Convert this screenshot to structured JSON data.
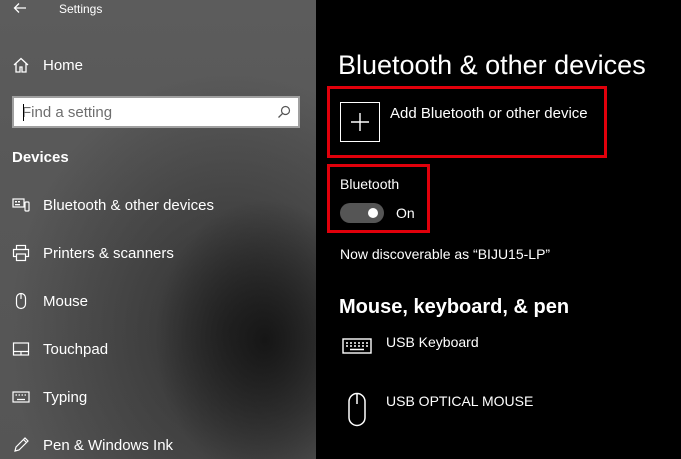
{
  "window": {
    "title": "Settings"
  },
  "sidebar": {
    "home_label": "Home",
    "search": {
      "placeholder": "Find a setting"
    },
    "section_title": "Devices",
    "items": [
      {
        "label": "Bluetooth & other devices",
        "icon": "bluetooth-devices-icon"
      },
      {
        "label": "Printers & scanners",
        "icon": "printer-icon"
      },
      {
        "label": "Mouse",
        "icon": "mouse-icon"
      },
      {
        "label": "Touchpad",
        "icon": "touchpad-icon"
      },
      {
        "label": "Typing",
        "icon": "keyboard-icon"
      },
      {
        "label": "Pen & Windows Ink",
        "icon": "pen-icon"
      }
    ]
  },
  "main": {
    "title": "Bluetooth & other devices",
    "add_device_label": "Add Bluetooth or other device",
    "bluetooth": {
      "label": "Bluetooth",
      "state": "On",
      "enabled": true
    },
    "discoverable_text": "Now discoverable as “BIJU15-LP”",
    "input_section_title": "Mouse, keyboard, & pen",
    "devices": [
      {
        "name": "USB Keyboard",
        "icon": "keyboard-icon"
      },
      {
        "name": "USB OPTICAL MOUSE",
        "icon": "mouse-icon"
      }
    ]
  },
  "colors": {
    "highlight": "#e0000b",
    "sidebar_bg": "#5a5a5a",
    "main_bg": "#000000",
    "toggle_track": "#555555"
  }
}
